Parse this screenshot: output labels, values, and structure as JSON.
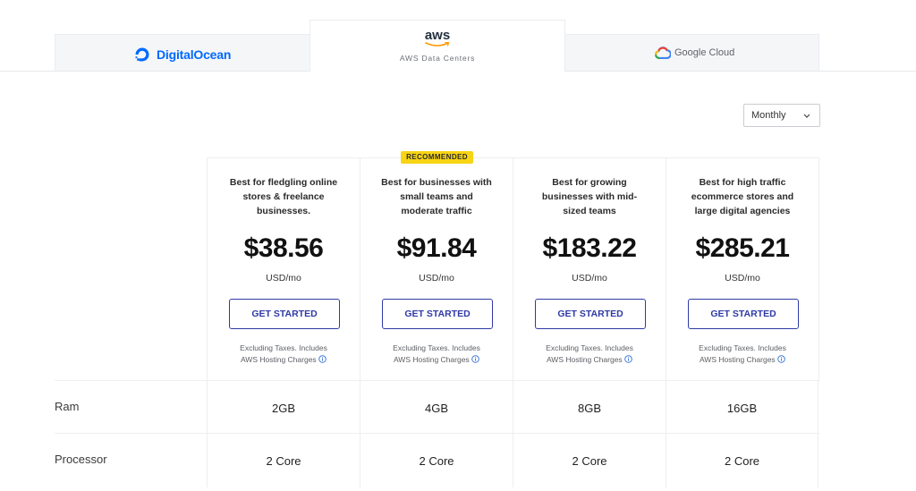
{
  "providers": {
    "digitalocean": {
      "label": "DigitalOcean",
      "icon": "digitalocean-logo-icon",
      "color": "#0069ff"
    },
    "aws": {
      "logo_text": "aws",
      "label": "AWS Data Centers",
      "icon": "aws-logo-icon",
      "active": true
    },
    "googlecloud": {
      "label": "Google Cloud",
      "icon": "google-cloud-logo-icon"
    }
  },
  "billing": {
    "selected": "Monthly",
    "icon": "chevron-down-icon"
  },
  "badge": {
    "label": "RECOMMENDED",
    "color": "#f7d414"
  },
  "plans": [
    {
      "description": "Best for fledgling online stores & freelance businesses.",
      "price": "$38.56",
      "unit": "USD/mo",
      "cta": "GET STARTED",
      "note_line1": "Excluding Taxes. Includes",
      "note_line2": "AWS Hosting Charges"
    },
    {
      "description": "Best for businesses with small teams and moderate traffic",
      "price": "$91.84",
      "unit": "USD/mo",
      "cta": "GET STARTED",
      "note_line1": "Excluding Taxes. Includes",
      "note_line2": "AWS Hosting Charges"
    },
    {
      "description": "Best for growing businesses with mid-sized teams",
      "price": "$183.22",
      "unit": "USD/mo",
      "cta": "GET STARTED",
      "note_line1": "Excluding Taxes. Includes",
      "note_line2": "AWS Hosting Charges"
    },
    {
      "description": "Best for high traffic ecommerce stores and large digital agencies",
      "price": "$285.21",
      "unit": "USD/mo",
      "cta": "GET STARTED",
      "note_line1": "Excluding Taxes. Includes",
      "note_line2": "AWS Hosting Charges"
    }
  ],
  "specs": [
    {
      "label": "Ram",
      "values": [
        "2GB",
        "4GB",
        "8GB",
        "16GB"
      ]
    },
    {
      "label": "Processor",
      "values": [
        "2 Core",
        "2 Core",
        "2 Core",
        "2 Core"
      ]
    }
  ],
  "colors": {
    "accent": "#2f3aa5",
    "info_icon": "#2f6fd6"
  }
}
